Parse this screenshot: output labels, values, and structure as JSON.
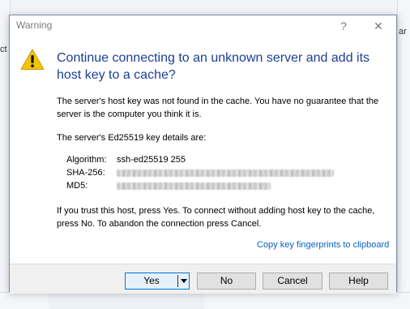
{
  "dialog": {
    "title": "Warning",
    "help_glyph": "?",
    "close_glyph": "✕",
    "heading": "Continue connecting to an unknown server and add its host key to a cache?",
    "paragraph_1": "The server's host key was not found in the cache. You have no guarantee that the server is the computer you think it is.",
    "paragraph_2": "The server's Ed25519 key details are:",
    "key_details": [
      {
        "label": "Algorithm:",
        "value": "ssh-ed25519 255"
      },
      {
        "label": "SHA-256:",
        "value": ""
      },
      {
        "label": "MD5:",
        "value": ""
      }
    ],
    "paragraph_3": "If you trust this host, press Yes. To connect without adding host key to the cache, press No. To abandon the connection press Cancel.",
    "copy_link": "Copy key fingerprints to clipboard",
    "buttons": {
      "yes": "Yes",
      "no": "No",
      "cancel": "Cancel",
      "help": "Help"
    }
  },
  "background": {
    "peek_left": "ct",
    "peek_right": "ar"
  },
  "icons": {
    "warning": "warning-icon",
    "help": "help-icon",
    "close": "close-icon",
    "dropdown": "chevron-down-icon"
  },
  "colors": {
    "heading": "#1c3f95",
    "link": "#0b61c5",
    "warning_fill": "#f5c400",
    "default_button_border": "#0078d7"
  }
}
